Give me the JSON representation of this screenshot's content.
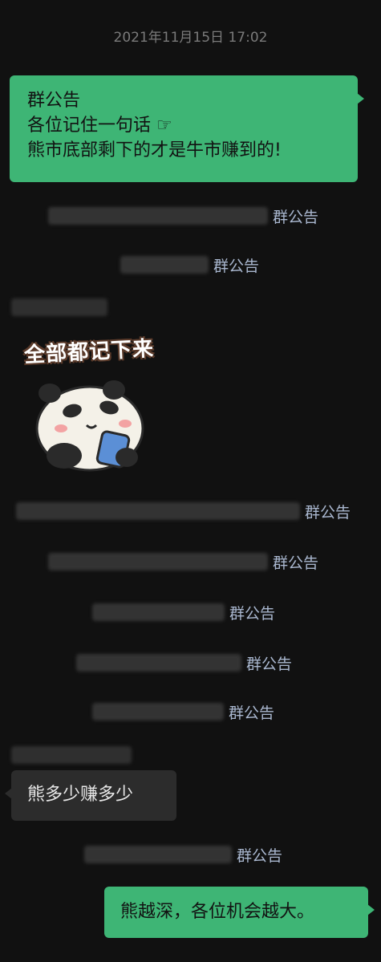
{
  "chat": {
    "timestamp": "2021年11月15日 17:02",
    "announcement": {
      "line1": "群公告",
      "line2": "各位记住一句话 ☞",
      "line3": "熊市底部剩下的才是牛市赚到的!"
    },
    "system_link": "群公告",
    "sticker": {
      "caption": "全部都记下来",
      "icon": "panda-sticker"
    },
    "message_gray": "熊多少赚多少",
    "message_green_bottom": "熊越深，各位机会越大。"
  },
  "colors": {
    "background": "#111111",
    "green_bubble": "#3eb575",
    "gray_bubble": "#2c2c2c",
    "link": "#a9b7cf",
    "timestamp": "#7a7a7a"
  }
}
